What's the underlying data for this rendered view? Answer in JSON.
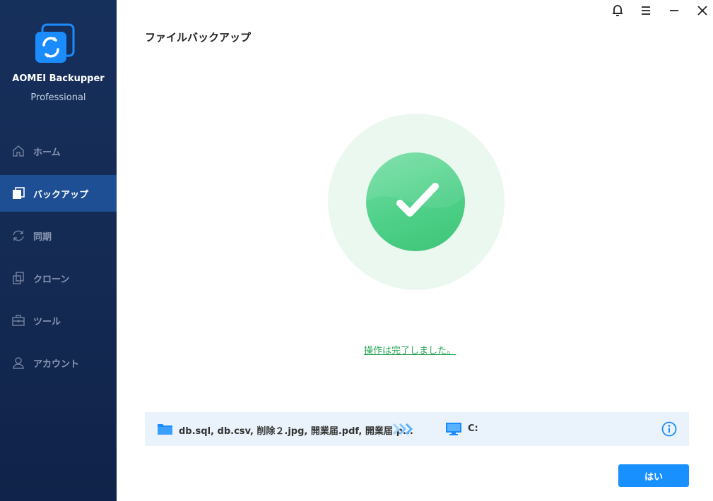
{
  "app": {
    "name": "AOMEI Backupper",
    "edition": "Professional"
  },
  "sidebar": {
    "items": [
      {
        "label": "ホーム",
        "icon": "home-icon",
        "active": false
      },
      {
        "label": "バックアップ",
        "icon": "backup-icon",
        "active": true
      },
      {
        "label": "同期",
        "icon": "sync-icon",
        "active": false
      },
      {
        "label": "クローン",
        "icon": "clone-icon",
        "active": false
      },
      {
        "label": "ツール",
        "icon": "tools-icon",
        "active": false
      },
      {
        "label": "アカウント",
        "icon": "account-icon",
        "active": false
      }
    ]
  },
  "titlebar": {
    "buttons": [
      "bell-icon",
      "menu-icon",
      "minimize-icon",
      "close-icon"
    ]
  },
  "page": {
    "title": "ファイルバックアップ",
    "status_message": "操作は完了しました。"
  },
  "task": {
    "source": "db.sql, db.csv, 削除２.jpg, 開業届.pdf, 開業届.p...",
    "destination": "C:"
  },
  "actions": {
    "ok_label": "はい"
  },
  "colors": {
    "sidebar_bg": "#142a52",
    "active_item": "#1e4f94",
    "success_green": "#4fd089",
    "link_green": "#27a653",
    "primary_blue": "#1890ff"
  }
}
